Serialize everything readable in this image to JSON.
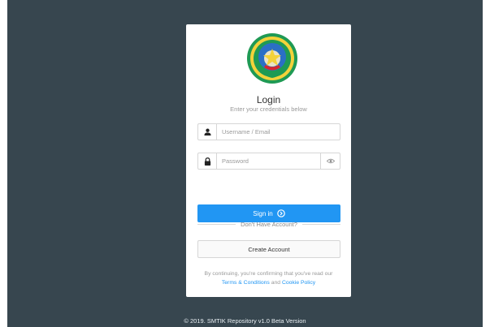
{
  "login": {
    "title": "Login",
    "subtitle": "Enter your credentials below",
    "username_placeholder": "Username / Email",
    "password_placeholder": "Password",
    "signin_label": "Sign in",
    "divider_text": "Don't Have Account?",
    "create_label": "Create Account",
    "terms_prefix": "By continuing, you're confirming that you've read our",
    "terms_link": "Terms & Conditions",
    "terms_and": "and",
    "cookie_link": "Cookie Policy"
  },
  "footer": {
    "text": "© 2019. SMTIK Repository v1.0 Beta Version"
  },
  "colors": {
    "background": "#37464f",
    "accent": "#2196f3",
    "logo_green": "#1f9a54",
    "logo_yellow": "#f3d23a"
  },
  "icons": {
    "user": "user-icon",
    "lock": "lock-icon",
    "eye": "eye-icon",
    "arrow": "arrow-circle-right-icon"
  }
}
